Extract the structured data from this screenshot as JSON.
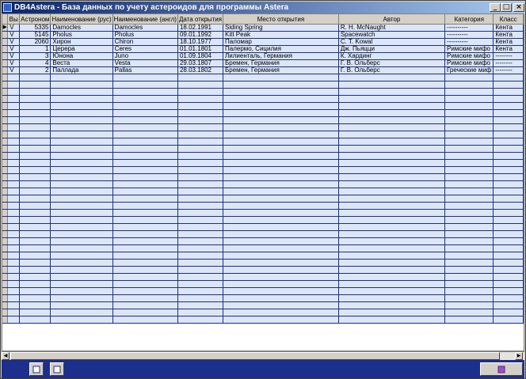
{
  "window": {
    "title": "DB4Astera - База данных по учету астероидов для программы Astera"
  },
  "titlebar_buttons": {
    "minimize": "_",
    "maximize": "□",
    "close": "×"
  },
  "grid": {
    "columns": [
      "Вы",
      "Астроном",
      "Наименование (рус)",
      "Наименование (англ)",
      "Дата открытия",
      "Место открытия",
      "Автор",
      "Категория",
      "Класс"
    ],
    "rows": [
      [
        "V",
        "5335",
        "Damocles",
        "Damocles",
        "18.02.1991",
        "Siding Spring",
        "R. H. McNaught",
        "----------",
        "Кента"
      ],
      [
        "V",
        "5145",
        "Pholus",
        "Pholus",
        "09.01.1992",
        "Kitt Peak",
        "Spacewatch",
        "----------",
        "Кента"
      ],
      [
        "V",
        "2060",
        "Хирон",
        "Chiron",
        "18.10.1977",
        "Паломар",
        "C. T. Kowal",
        "----------",
        "Кента"
      ],
      [
        "V",
        "1",
        "Церера",
        "Ceres",
        "01.01.1801",
        "Палермо, Сицилия",
        "Дж. Пьяцци",
        "Римские мифо",
        "Кента"
      ],
      [
        "V",
        "3",
        "Юнона",
        "Juno",
        "01.09.1804",
        "Лилиенталь, Германия",
        "К. Хардинг",
        "Римские мифо",
        "--------"
      ],
      [
        "V",
        "4",
        "Веста",
        "Vesta",
        "29.03.1807",
        "Бремен, Германия",
        "Г. В. Ольберс",
        "Римские мифо",
        "--------"
      ],
      [
        "V",
        "2",
        "Паллада",
        "Pallas",
        "28.03.1802",
        "Бремен, Германия",
        "Г. В. Ольберс",
        "Греческие миф",
        "--------"
      ]
    ],
    "current_row_marker": "▶"
  },
  "scrollbar": {
    "left_arrow": "◀",
    "right_arrow": "▶"
  },
  "toolbar": {
    "icons": [
      "table-view-icon",
      "record-view-icon",
      "exit-icon"
    ]
  }
}
